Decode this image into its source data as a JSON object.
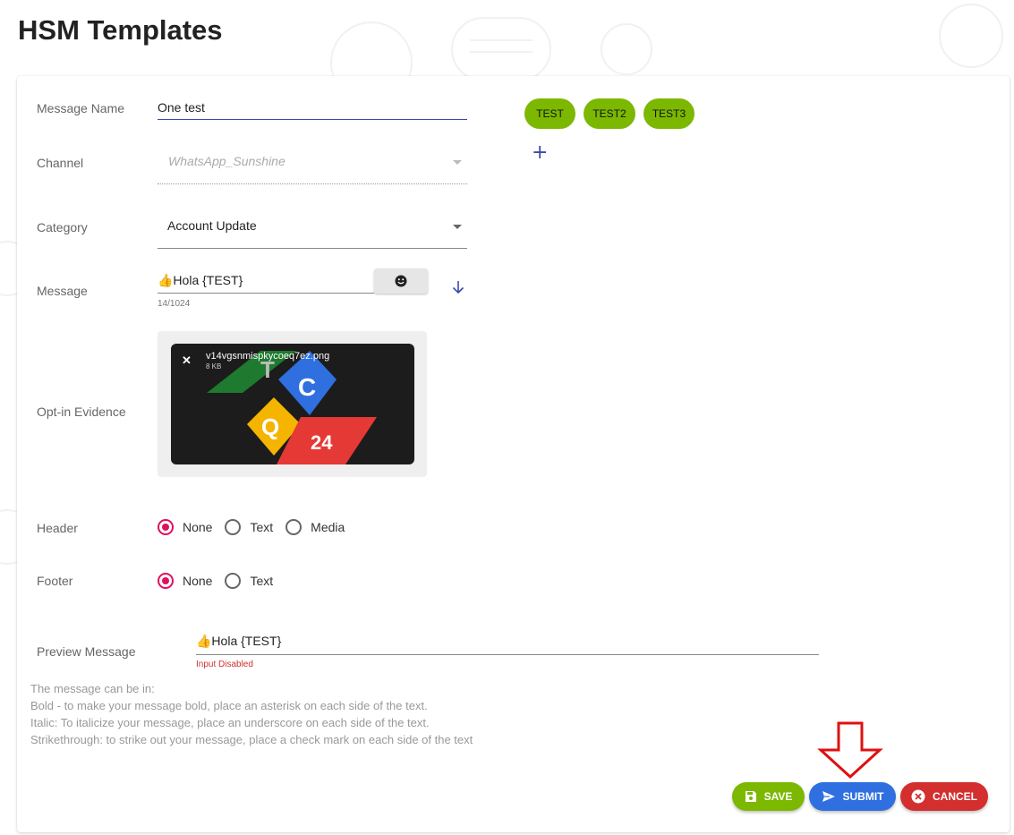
{
  "page": {
    "title": "HSM Templates"
  },
  "form": {
    "message_name": {
      "label": "Message Name",
      "value": "One test"
    },
    "channel": {
      "label": "Channel",
      "value": "WhatsApp_Sunshine"
    },
    "category": {
      "label": "Category",
      "value": "Account Update"
    },
    "message": {
      "label": "Message",
      "value": "👍Hola {TEST}",
      "counter": "14/1024"
    },
    "optin": {
      "label": "Opt-in Evidence",
      "file_name": "v14vgsnmispkycoeq7ez.png",
      "file_size": "8 KB",
      "image_letters": [
        "T",
        "C",
        "Q",
        "24"
      ]
    },
    "header": {
      "label": "Header",
      "options": [
        "None",
        "Text",
        "Media"
      ],
      "selected": "None"
    },
    "footer": {
      "label": "Footer",
      "options": [
        "None",
        "Text"
      ],
      "selected": "None"
    },
    "preview": {
      "label": "Preview Message",
      "value": "👍Hola {TEST}",
      "status": "Input Disabled"
    }
  },
  "tags": [
    "TEST",
    "TEST2",
    "TEST3"
  ],
  "help": {
    "lines": [
      "The message can be in:",
      "Bold - to make your message bold, place an asterisk on each side of the text.",
      "Italic: To italicize your message, place an underscore on each side of the text.",
      "Strikethrough: to strike out your message, place a check mark on each side of the text"
    ]
  },
  "actions": {
    "save": "SAVE",
    "submit": "SUBMIT",
    "cancel": "CANCEL"
  },
  "colors": {
    "tag": "#7cb800",
    "save": "#7cb800",
    "submit": "#2f6fe0",
    "cancel": "#d32f2f",
    "radio_checked": "#e0105f",
    "accent": "#3b4aa8",
    "annotation_arrow": "#e01010"
  }
}
